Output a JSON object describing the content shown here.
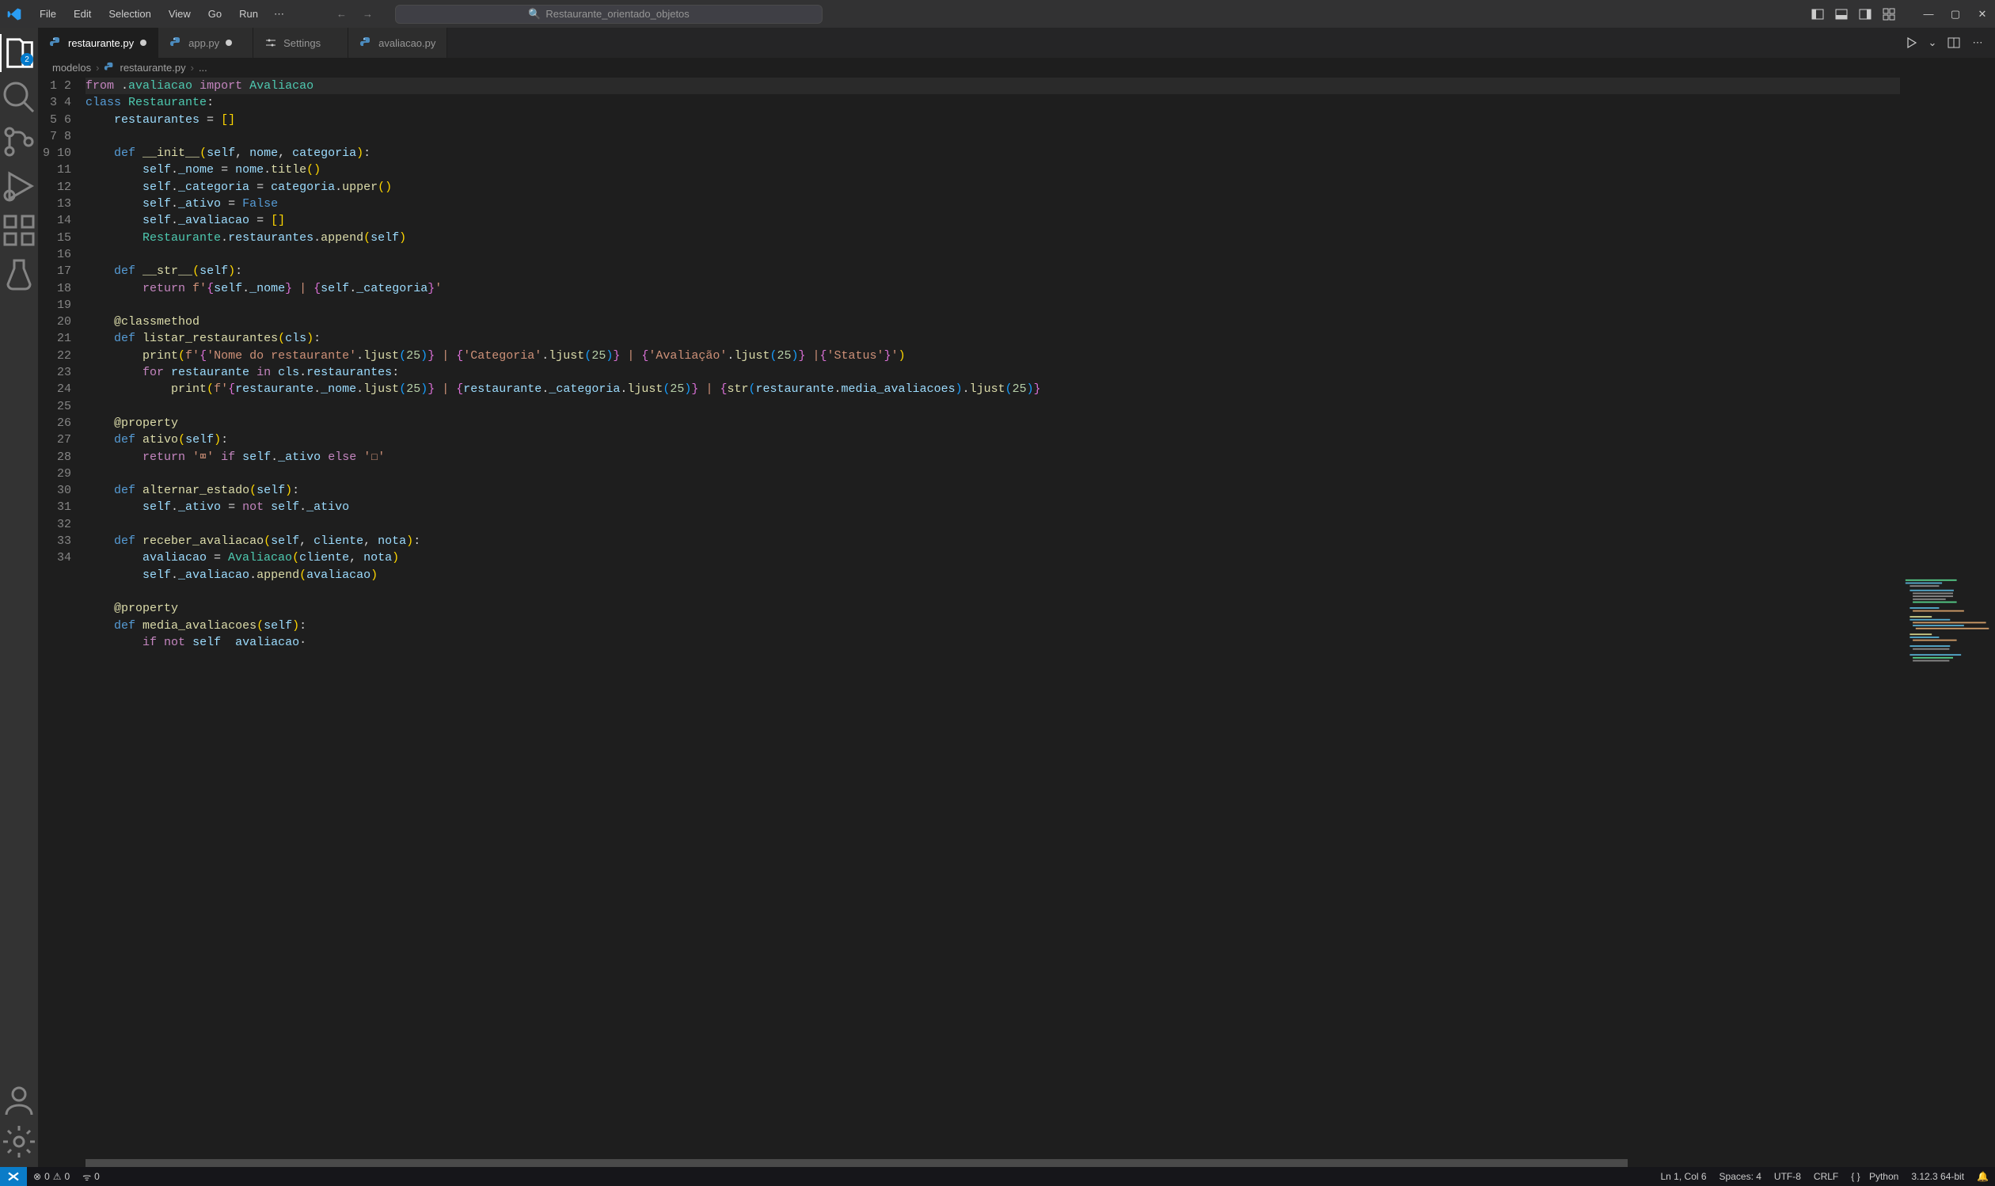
{
  "menu": [
    "File",
    "Edit",
    "Selection",
    "View",
    "Go",
    "Run"
  ],
  "search_placeholder": "Restaurante_orientado_objetos",
  "explorer_badge": "2",
  "tabs": [
    {
      "label": "restaurante.py",
      "icon": "python",
      "dirty": true,
      "active": true
    },
    {
      "label": "app.py",
      "icon": "python",
      "dirty": true,
      "active": false
    },
    {
      "label": "Settings",
      "icon": "settings",
      "dirty": false,
      "active": false
    },
    {
      "label": "avaliacao.py",
      "icon": "python",
      "dirty": false,
      "active": false
    }
  ],
  "breadcrumb": {
    "folder": "modelos",
    "file": "restaurante.py",
    "tail": "..."
  },
  "line_count": 34,
  "status": {
    "errors": "0",
    "warnings": "0",
    "ports": "0",
    "cursor": "Ln 1, Col 6",
    "spaces": "Spaces: 4",
    "encoding": "UTF-8",
    "eol": "CRLF",
    "lang": "Python",
    "interpreter": "3.12.3 64-bit"
  }
}
